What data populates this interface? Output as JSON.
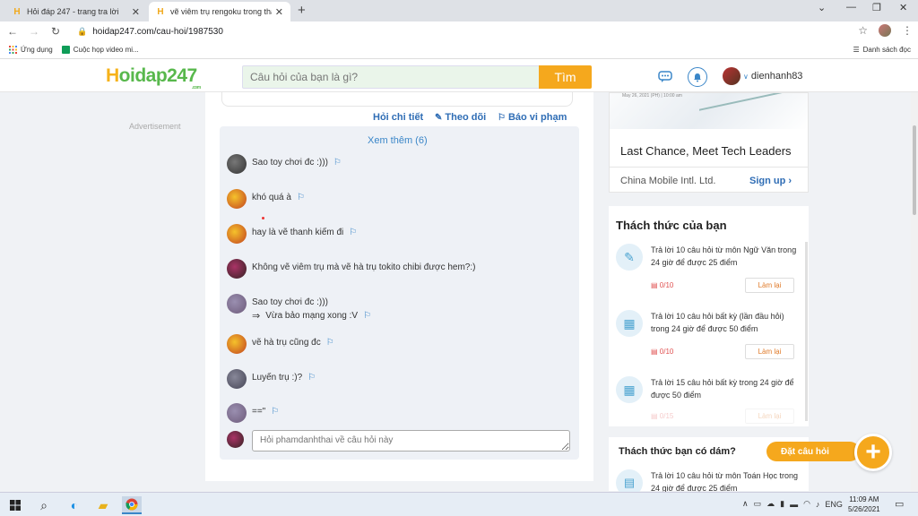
{
  "browser": {
    "tabs": [
      {
        "title": "Hỏi đáp 247 - trang tra lời"
      },
      {
        "title": "vẽ viêm trụ rengoku trong thanh..."
      }
    ],
    "url": "hoidap247.com/cau-hoi/1987530",
    "bookmarks": [
      {
        "label": "Ứng dụng"
      },
      {
        "label": "Cuộc họp video mi..."
      }
    ],
    "reading_list": "Danh sách đọc"
  },
  "site": {
    "logo": {
      "first": "H",
      "rest": "oidap247",
      "suffix": ".com"
    },
    "search_placeholder": "Câu hỏi của bạn là gì?",
    "search_button": "Tìm",
    "username": "dienhanh83"
  },
  "main": {
    "advertisement": "Advertisement",
    "actions": {
      "detail": "Hỏi chi tiết",
      "follow": "Theo dõi",
      "report": "Báo vi phạm"
    },
    "see_more": "Xem thêm (6)",
    "comments": [
      {
        "text": "Sao toy chơi đc :)))"
      },
      {
        "text": "khó quá à"
      },
      {
        "text": "hay là vẽ thanh kiếm đi"
      },
      {
        "text": "Không vẽ viêm trụ mà vẽ hà trụ tokito chibi được hem?:)"
      },
      {
        "text": "Sao toy chơi đc :)))",
        "reply": "Vừa bảo mạng xong :V"
      },
      {
        "text": "vẽ hà trụ cũng đc"
      },
      {
        "text": "Luyến trụ :)?"
      },
      {
        "text": "==\""
      }
    ],
    "comment_placeholder": "Hỏi phamdanhthai về câu hỏi này"
  },
  "sidebar": {
    "ad": {
      "date": "May 26, 2021 (PH) | 10:00 am",
      "title": "Last Chance, Meet Tech Leaders",
      "company": "China Mobile Intl. Ltd.",
      "cta": "Sign up"
    },
    "challenge_title": "Thách thức của bạn",
    "challenges": [
      {
        "text": "Trả lời 10 câu hỏi  từ môn Ngữ Văn trong 24 giờ để được 25 điểm",
        "progress": "0/10",
        "button": "Làm lại"
      },
      {
        "text": "Trả lời 10 câu hỏi  bất kỳ (lần đầu hỏi) trong 24 giờ để được 50 điểm",
        "progress": "0/10",
        "button": "Làm lại"
      },
      {
        "text": "Trả lời 15 câu hỏi  bất kỳ  trong 24 giờ để được 50 điểm",
        "progress": "0/15",
        "button": "Làm lại"
      }
    ],
    "dare_title": "Thách thức bạn có dám?",
    "dare_item": "Trả lời 10 câu hỏi  từ môn Toán Học trong 24 giờ để được 25 điểm",
    "ask_button": "Đặt câu hỏi"
  },
  "taskbar": {
    "lang": "ENG",
    "time": "11:09 AM",
    "date": "5/26/2021"
  },
  "colors": {
    "brand_green": "#58b84c",
    "brand_orange": "#f5a81d",
    "link_blue": "#2f6db5"
  }
}
